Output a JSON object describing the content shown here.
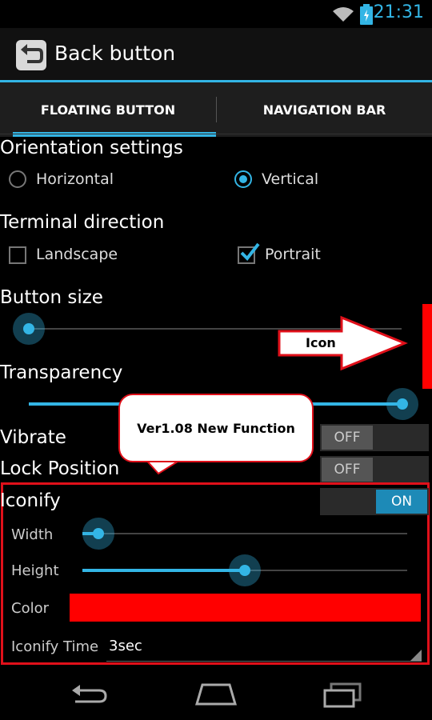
{
  "status_bar": {
    "time": "21:31"
  },
  "action_bar": {
    "title": "Back button"
  },
  "tabs": [
    {
      "label": "FLOATING BUTTON",
      "selected": true
    },
    {
      "label": "NAVIGATION BAR",
      "selected": false
    }
  ],
  "orientation": {
    "heading": "Orientation settings",
    "options": [
      {
        "label": "Horizontal",
        "checked": false
      },
      {
        "label": "Vertical",
        "checked": true
      }
    ]
  },
  "terminal": {
    "heading": "Terminal direction",
    "options": [
      {
        "label": "Landscape",
        "checked": false
      },
      {
        "label": "Portrait",
        "checked": true
      }
    ]
  },
  "button_size": {
    "heading": "Button size",
    "value": 0.0
  },
  "transparency": {
    "heading": "Transparency",
    "value": 1.0
  },
  "vibrate": {
    "label": "Vibrate",
    "state": "OFF"
  },
  "lock_position": {
    "label": "Lock Position",
    "state": "OFF"
  },
  "iconify": {
    "label": "Iconify",
    "state": "ON",
    "width": {
      "label": "Width",
      "value": 0.05
    },
    "height": {
      "label": "Height",
      "value": 0.5
    },
    "color": {
      "label": "Color",
      "value": "#ff0000"
    },
    "time": {
      "label": "Iconify Time",
      "value": "3sec"
    }
  },
  "annotations": {
    "arrow_text": "Icon",
    "bubble_text": "Ver1.08 New Function"
  },
  "colors": {
    "accent": "#33b5e5",
    "annotation_red": "#e0101a"
  }
}
